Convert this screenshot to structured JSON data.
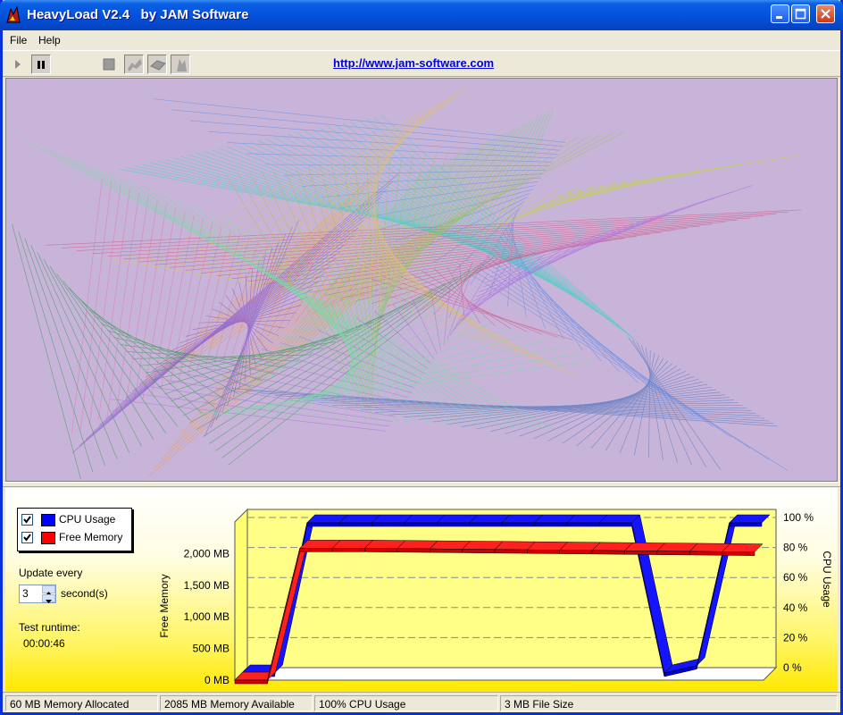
{
  "window": {
    "title": "HeavyLoad V2.4   by JAM Software"
  },
  "menu": {
    "items": [
      "File",
      "Help"
    ]
  },
  "toolbar": {
    "buttons": [
      "play-icon",
      "pause-icon",
      "stop-icon",
      "cpu-load-icon",
      "disk-load-icon",
      "memory-load-icon"
    ],
    "url": "http://www.jam-software.com"
  },
  "legend": {
    "items": [
      {
        "label": "CPU Usage",
        "checked": true,
        "color": "#0000ff"
      },
      {
        "label": "Free Memory",
        "checked": true,
        "color": "#ff0000"
      }
    ]
  },
  "settings": {
    "update_label": "Update every",
    "update_value": "3",
    "seconds_label": "second(s)",
    "runtime_label": "Test runtime:",
    "runtime_value": "00:00:46"
  },
  "status": {
    "memory_allocated": "60 MB Memory Allocated",
    "memory_available": "2085 MB Memory Available",
    "cpu_usage": "100% CPU Usage",
    "file_size": "3 MB File Size"
  },
  "colors": {
    "title_bar": "#0453dc",
    "cpu_series": "#0000ff",
    "memory_series": "#ff0000",
    "chart_background": "#ffff80"
  },
  "chart_data": {
    "type": "line",
    "x": [
      0,
      1,
      2,
      3,
      4,
      5,
      6,
      7,
      8,
      9,
      10,
      11,
      12,
      13,
      14,
      15,
      16
    ],
    "series": [
      {
        "name": "CPU Usage",
        "axis": "right",
        "values": [
          0,
          0,
          100,
          100,
          100,
          100,
          100,
          100,
          100,
          100,
          100,
          100,
          100,
          0,
          5,
          100,
          100
        ]
      },
      {
        "name": "Free Memory",
        "axis": "left",
        "values": [
          0,
          0,
          2085,
          2085,
          2085,
          2080,
          2075,
          2070,
          2065,
          2060,
          2055,
          2050,
          2045,
          2040,
          2035,
          2030,
          2025
        ]
      }
    ],
    "ylabel": "Free Memory",
    "y2label": "CPU Usage",
    "left_ticks": [
      "0 MB",
      "500 MB",
      "1,000 MB",
      "1,500 MB",
      "2,000 MB"
    ],
    "right_ticks": [
      "0 %",
      "20 %",
      "40 %",
      "60 %",
      "80 %",
      "100 %"
    ],
    "ylim": [
      0,
      2500
    ],
    "y2lim": [
      0,
      100
    ]
  }
}
